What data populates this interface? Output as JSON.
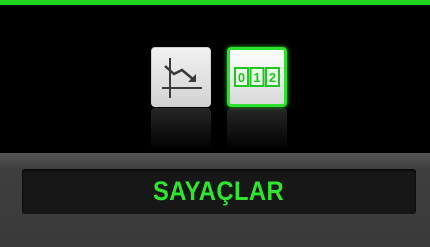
{
  "screen": {
    "title": "SAYAÇLAR",
    "accent_color": "#1fd51f"
  },
  "icons": [
    {
      "name": "trend-graph-icon",
      "selected": false
    },
    {
      "name": "counter-icon",
      "selected": true,
      "digits": [
        "0",
        "1",
        "2"
      ]
    }
  ]
}
